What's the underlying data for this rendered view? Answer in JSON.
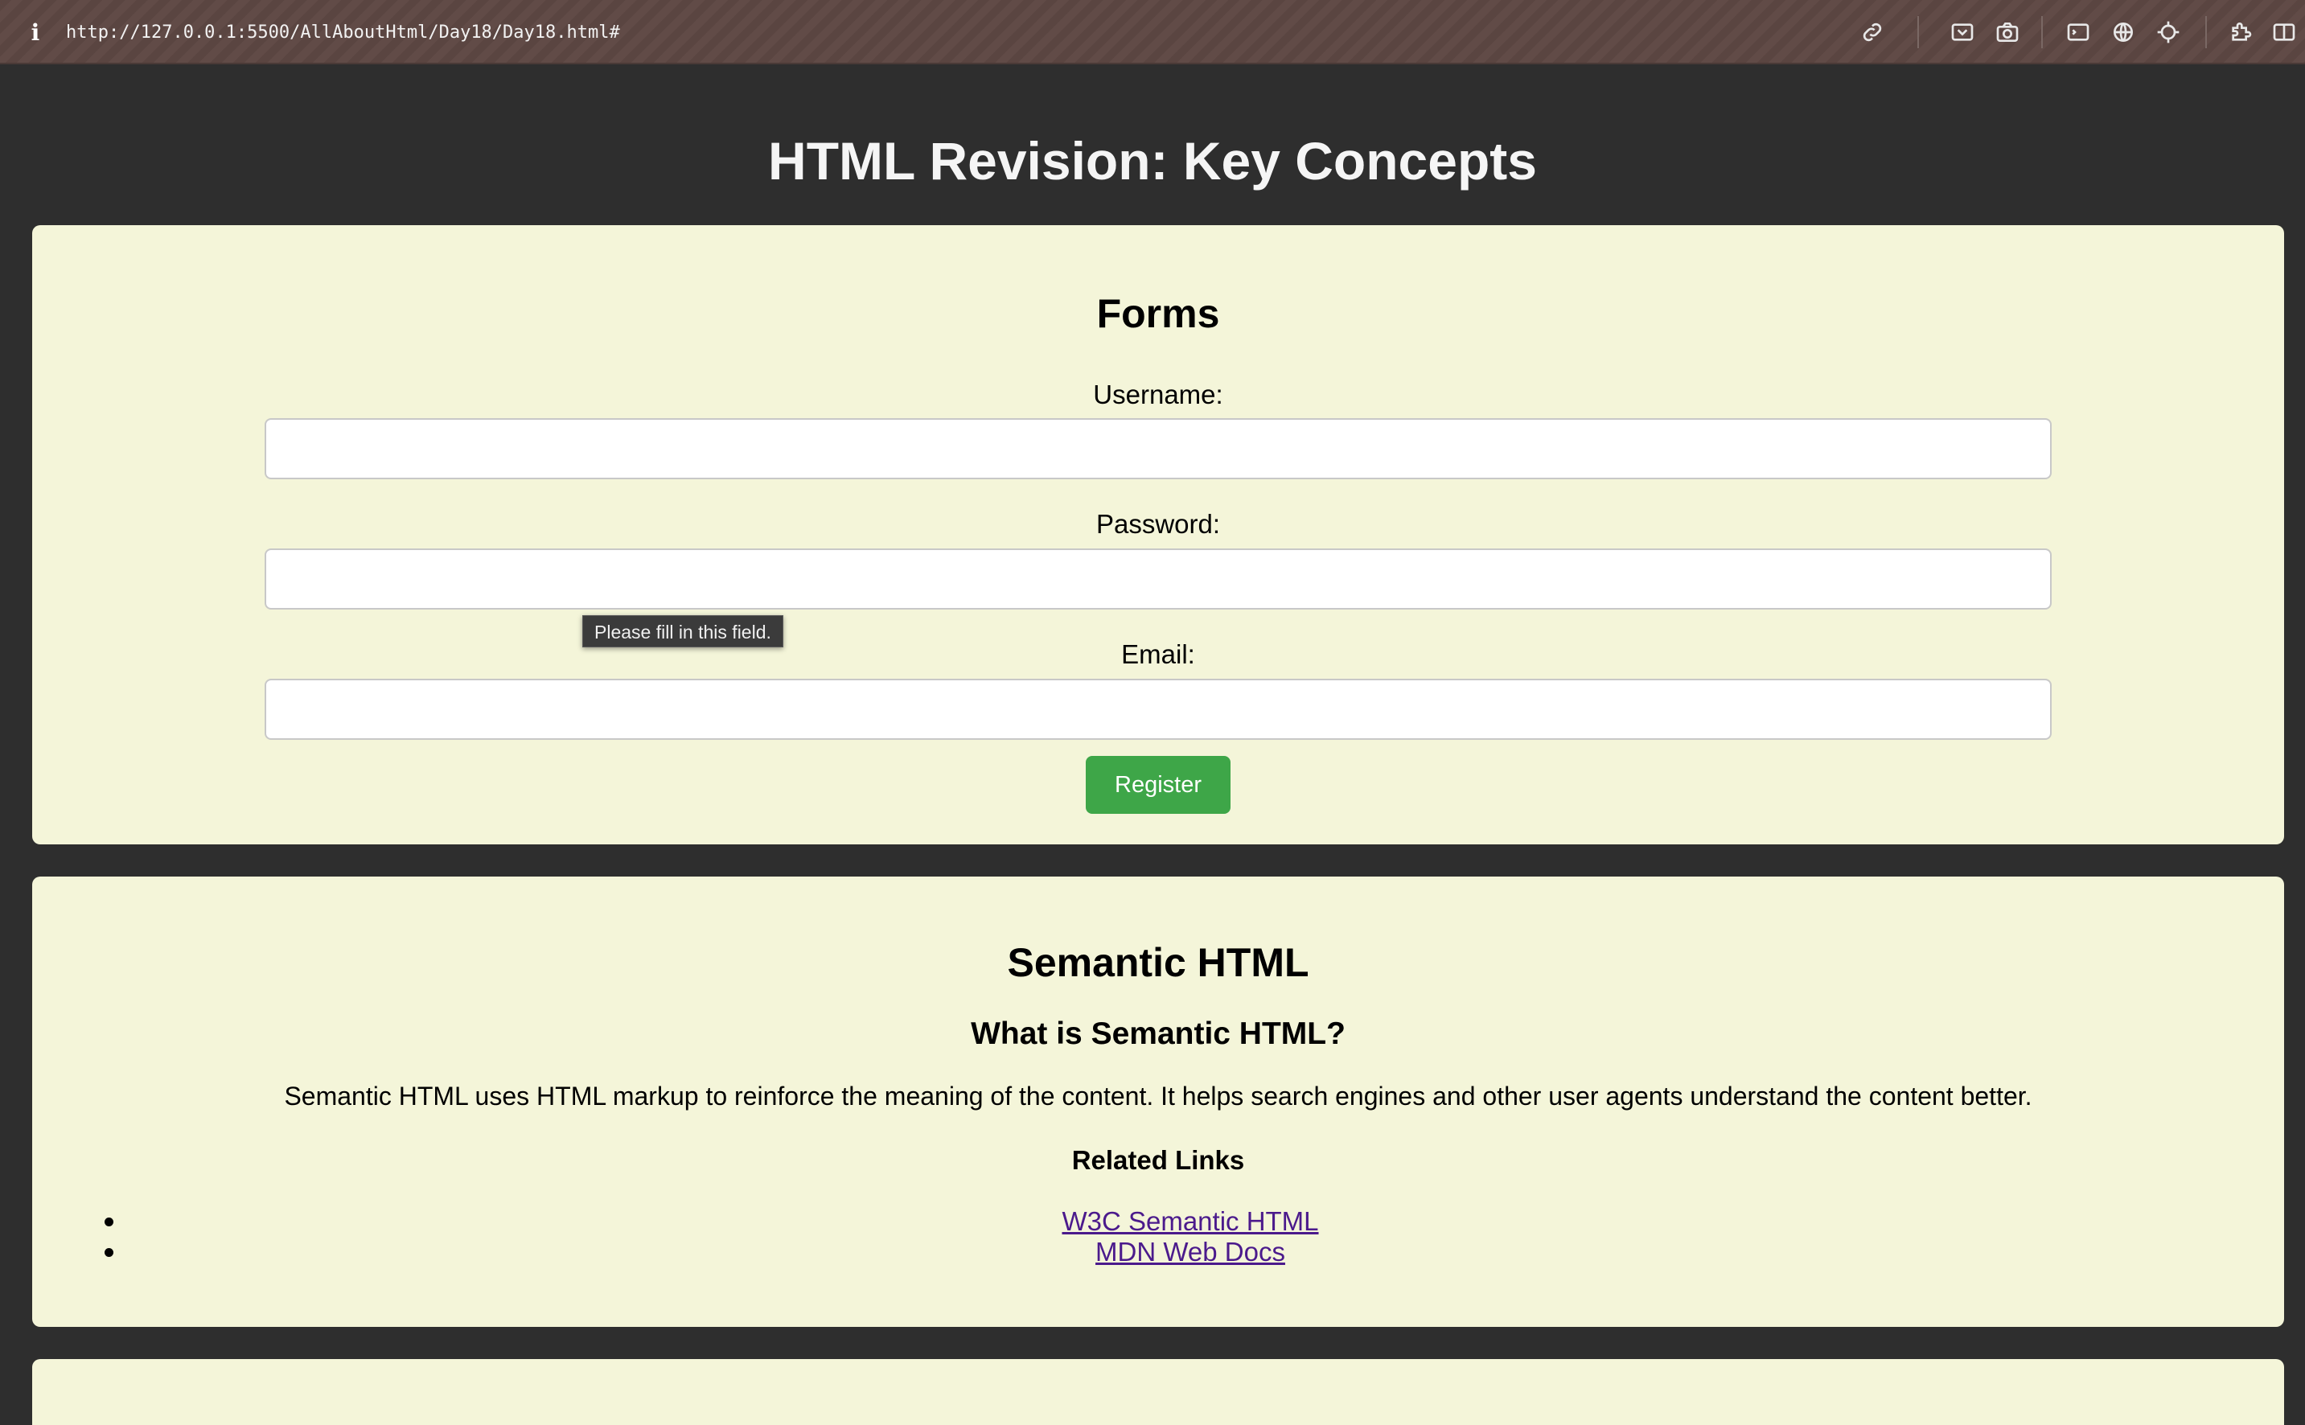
{
  "browser": {
    "url": "http://127.0.0.1:5500/AllAboutHtml/Day18/Day18.html#",
    "info_glyph": "i",
    "icons": [
      "link-icon",
      "screenshot-icon",
      "camera-icon",
      "terminal-icon",
      "globe-icon",
      "crosshair-icon",
      "extensions-icon",
      "sidebar-icon"
    ]
  },
  "page": {
    "title": "HTML Revision: Key Concepts"
  },
  "forms": {
    "heading": "Forms",
    "username_label": "Username:",
    "username_value": "",
    "password_label": "Password:",
    "password_value": "",
    "email_label": "Email:",
    "email_value": "",
    "validation_tooltip": "Please fill in this field.",
    "register_label": "Register",
    "register_color": "#3ea648"
  },
  "semantic": {
    "heading": "Semantic HTML",
    "subheading": "What is Semantic HTML?",
    "description": "Semantic HTML uses HTML markup to reinforce the meaning of the content. It helps search engines and other user agents understand the content better.",
    "links_heading": "Related Links",
    "links": [
      {
        "label": "W3C Semantic HTML"
      },
      {
        "label": "MDN Web Docs"
      }
    ]
  },
  "colors": {
    "background": "#2e2e2e",
    "card": "#f4f5d9",
    "link": "#4b1a8c"
  }
}
